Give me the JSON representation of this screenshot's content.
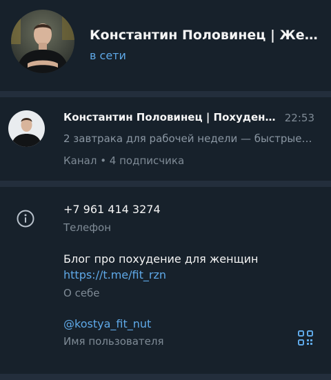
{
  "profile": {
    "name": "Константин Половинец | Женс...",
    "status": "в сети"
  },
  "channel": {
    "title": "Константин Половинец | Похудение ...",
    "time": "22:53",
    "message": "2 завтрака для рабочей недели — быстрые, ...",
    "meta": "Канал • 4 подписчика"
  },
  "info": {
    "phone": "+7 961 414 3274",
    "phone_label": "Телефон",
    "bio": "Блог про похудение для женщин",
    "bio_link": "https://t.me/fit_rzn",
    "bio_label": "О себе",
    "username": "@kostya_fit_nut",
    "username_label": "Имя пользователя"
  },
  "colors": {
    "background": "#17212b",
    "divider": "#232e3c",
    "accent": "#5fa9e8",
    "muted": "#7f8b96"
  },
  "icons": {
    "info": "info-circle-icon",
    "qr": "qr-code-icon"
  }
}
